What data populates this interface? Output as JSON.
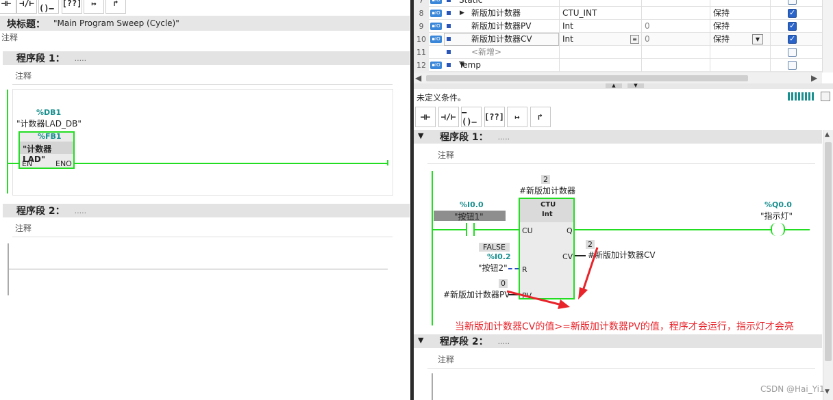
{
  "left": {
    "block_title_label": "块标题：",
    "block_title_value": "\"Main Program Sweep (Cycle)\"",
    "comment": "注释",
    "segments": [
      {
        "title": "程序段 1：",
        "dots": ".....",
        "comment": "注释"
      },
      {
        "title": "程序段 2：",
        "dots": ".....",
        "comment": "注释"
      }
    ],
    "fb": {
      "db_addr": "%DB1",
      "db_name": "\"计数器LAD_DB\"",
      "fb_addr": "%FB1",
      "fb_name": "\"计数器LAD\"",
      "en": "EN",
      "eno": "ENO"
    }
  },
  "right": {
    "table": {
      "rows": [
        {
          "num": "7",
          "indent": "",
          "name": "Static",
          "type": "",
          "default": "",
          "retain": "",
          "checked": false,
          "partial": true
        },
        {
          "num": "8",
          "expand": "▶",
          "name": "新版加计数器",
          "type": "CTU_INT",
          "default": "",
          "retain": "保持",
          "checked": true
        },
        {
          "num": "9",
          "name": "新版加计数器PV",
          "type": "Int",
          "default": "0",
          "retain": "保持",
          "checked": true
        },
        {
          "num": "10",
          "name": "新版加计数器CV",
          "type": "Int",
          "default": "0",
          "retain": "保持",
          "checked": true,
          "selected": true
        },
        {
          "num": "11",
          "name": "<新增>",
          "type": "",
          "default": "",
          "retain": "",
          "checked": false,
          "placeholder": true
        },
        {
          "num": "12",
          "expand": "▼",
          "name": "Temp",
          "type": "",
          "default": "",
          "retain": "",
          "checked": false,
          "section": true
        }
      ]
    },
    "status": "未定义条件。",
    "toolbar": [
      "⊣⊢",
      "⊣/⊢",
      "–()–",
      "[??]",
      "↦",
      "↱"
    ],
    "segments": [
      {
        "title": "程序段 1：",
        "dots": ".....",
        "comment": "注释"
      },
      {
        "title": "程序段 2：",
        "dots": ".....",
        "comment": "注释"
      }
    ],
    "ctu": {
      "instance_num": "2",
      "instance_name": "#新版加计数器",
      "type": "CTU",
      "dtype": "Int",
      "cu": "CU",
      "q": "Q",
      "r": "R",
      "cv": "CV",
      "pv": "PV",
      "cv_val": "2",
      "cv_name": "#新版加计数器CV",
      "pv_val": "0",
      "pv_name": "#新版加计数器PV"
    },
    "contact1": {
      "addr": "%I0.0",
      "name": "\"按钮1\""
    },
    "contact2": {
      "state": "FALSE",
      "addr": "%I0.2",
      "name": "\"按钮2\""
    },
    "coil": {
      "addr": "%Q0.0",
      "name": "\"指示灯\""
    },
    "annotation": "当新版加计数器CV的值>=新版加计数器PV的值，程序才会运行，指示灯才会亮",
    "watermark": "CSDN @Hai_Yi1"
  },
  "colors": {
    "ladder": "#22dd22",
    "annotation": "#e8232a",
    "teal": "#1a8f8f"
  }
}
